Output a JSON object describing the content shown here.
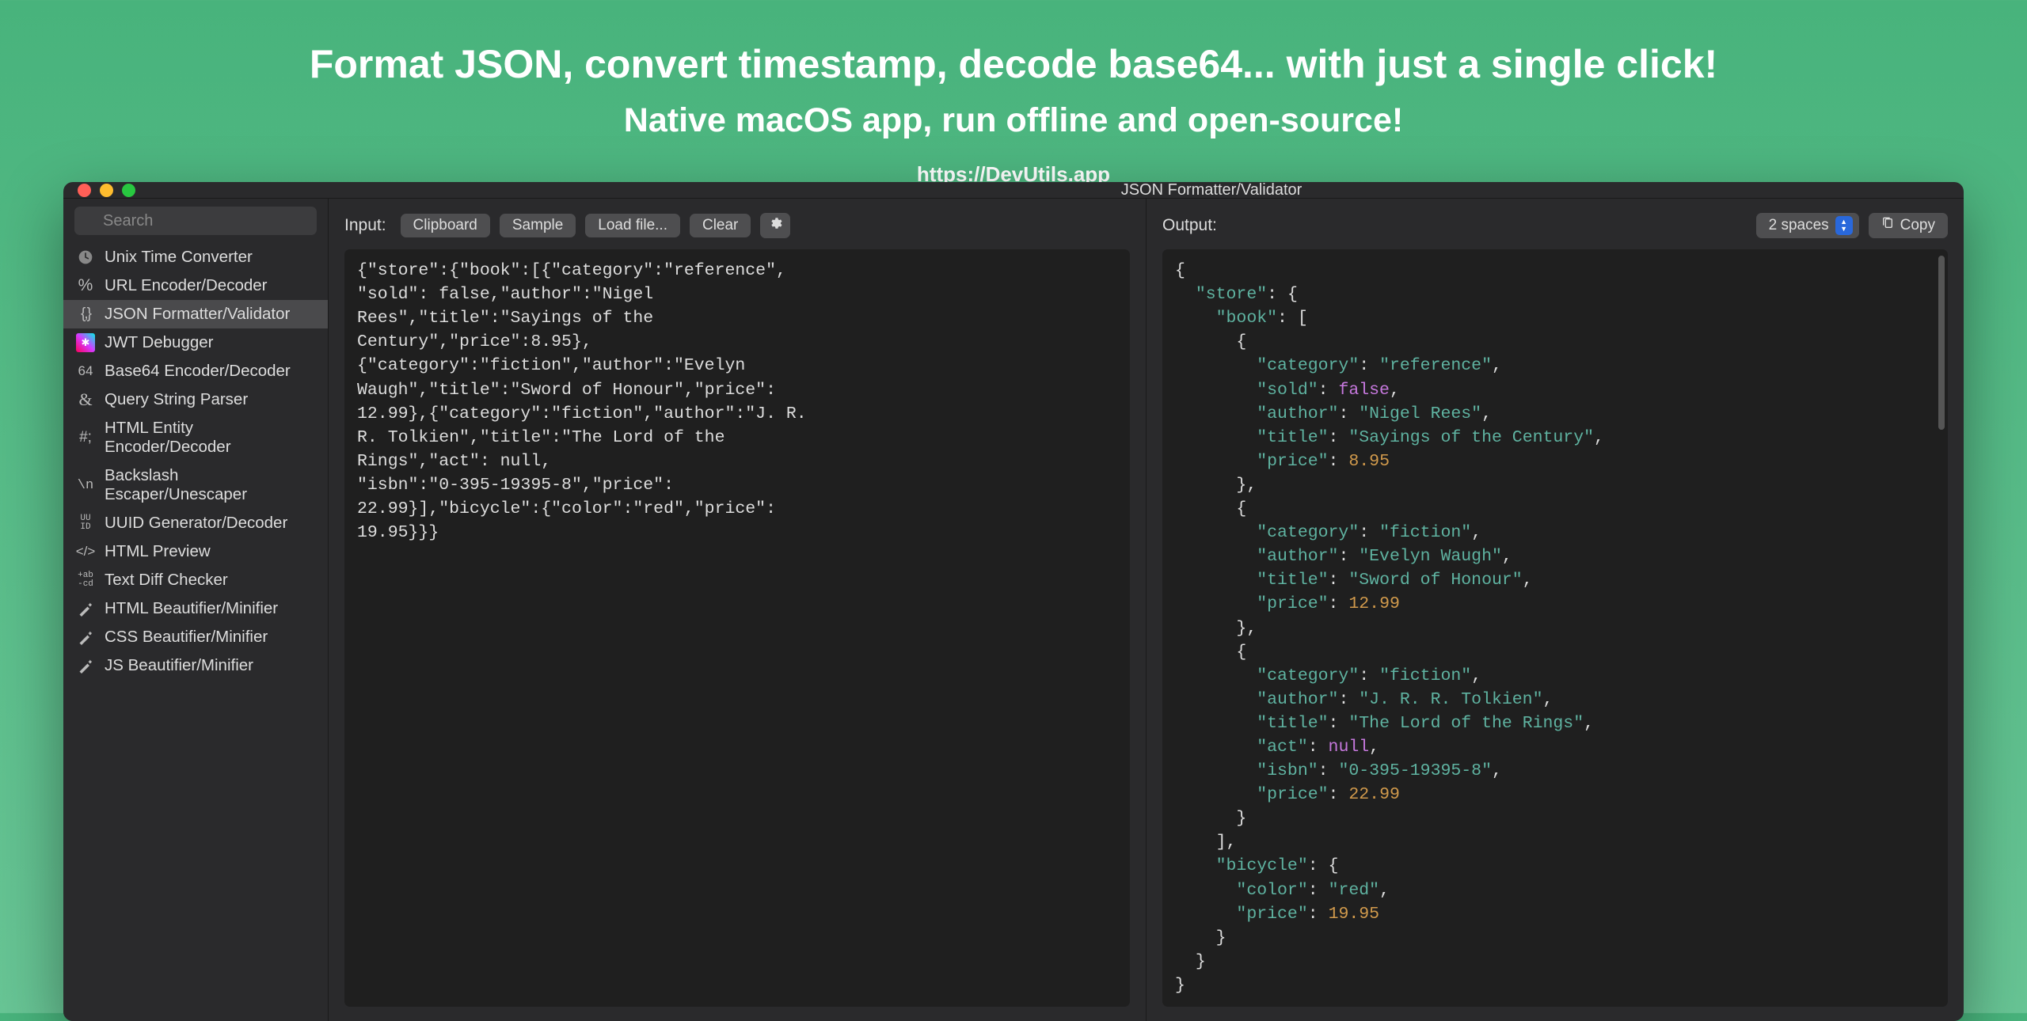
{
  "hero": {
    "line1": "Format JSON, convert timestamp, decode base64... with just a single click!",
    "line2": "Native macOS app, run offline and open-source!",
    "url": "https://DevUtils.app"
  },
  "window": {
    "title": "JSON Formatter/Validator"
  },
  "sidebar": {
    "search_placeholder": "Search",
    "items": [
      {
        "icon": "clock",
        "label": "Unix Time Converter"
      },
      {
        "icon": "percent",
        "label": "URL Encoder/Decoder"
      },
      {
        "icon": "braces",
        "label": "JSON Formatter/Validator",
        "selected": true
      },
      {
        "icon": "jwt",
        "label": "JWT Debugger"
      },
      {
        "icon": "b64",
        "label": "Base64 Encoder/Decoder"
      },
      {
        "icon": "amp",
        "label": "Query String Parser"
      },
      {
        "icon": "hash",
        "label": "HTML Entity Encoder/Decoder"
      },
      {
        "icon": "backslash",
        "label": "Backslash Escaper/Unescaper"
      },
      {
        "icon": "uuid",
        "label": "UUID Generator/Decoder"
      },
      {
        "icon": "html",
        "label": "HTML Preview"
      },
      {
        "icon": "diff",
        "label": "Text Diff Checker"
      },
      {
        "icon": "wand",
        "label": "HTML Beautifier/Minifier"
      },
      {
        "icon": "wand",
        "label": "CSS Beautifier/Minifier"
      },
      {
        "icon": "wand",
        "label": "JS Beautifier/Minifier"
      }
    ]
  },
  "input": {
    "label": "Input:",
    "buttons": {
      "clipboard": "Clipboard",
      "sample": "Sample",
      "loadfile": "Load file...",
      "clear": "Clear"
    },
    "content": "{\"store\":{\"book\":[{\"category\":\"reference\",\n\"sold\": false,\"author\":\"Nigel\nRees\",\"title\":\"Sayings of the\nCentury\",\"price\":8.95},\n{\"category\":\"fiction\",\"author\":\"Evelyn\nWaugh\",\"title\":\"Sword of Honour\",\"price\":\n12.99},{\"category\":\"fiction\",\"author\":\"J. R.\nR. Tolkien\",\"title\":\"The Lord of the\nRings\",\"act\": null,\n\"isbn\":\"0-395-19395-8\",\"price\":\n22.99}],\"bicycle\":{\"color\":\"red\",\"price\":\n19.95}}}"
  },
  "output": {
    "label": "Output:",
    "indent": "2 spaces",
    "copy_label": "Copy",
    "json": {
      "store": {
        "book": [
          {
            "category": "reference",
            "sold": false,
            "author": "Nigel Rees",
            "title": "Sayings of the Century",
            "price": 8.95
          },
          {
            "category": "fiction",
            "author": "Evelyn Waugh",
            "title": "Sword of Honour",
            "price": 12.99
          },
          {
            "category": "fiction",
            "author": "J. R. R. Tolkien",
            "title": "The Lord of the Rings",
            "act": null,
            "isbn": "0-395-19395-8",
            "price": 22.99
          }
        ],
        "bicycle": {
          "color": "red",
          "price": 19.95
        }
      }
    }
  }
}
